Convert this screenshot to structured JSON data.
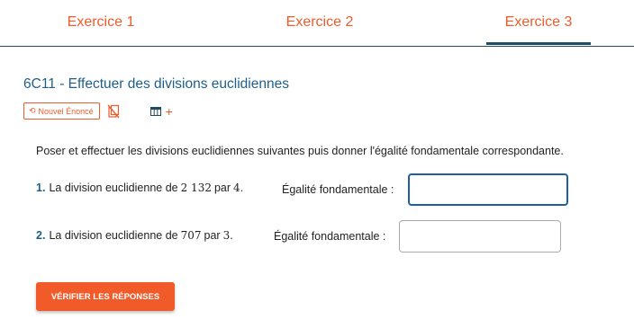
{
  "tabs": [
    {
      "label": "Exercice 1"
    },
    {
      "label": "Exercice 2"
    },
    {
      "label": "Exercice 3",
      "active": true
    }
  ],
  "exercise": {
    "title": "6C11 - Effectuer des divisions euclidiennes",
    "new_statement_label": "Nouvel Énoncé",
    "instruction": "Poser et effectuer les divisions euclidiennes suivantes puis donner l'égalité fondamentale correspondante.",
    "questions": [
      {
        "number": "1.",
        "text_before": "La division euclidienne de",
        "dividend": "2 132",
        "text_mid": "par",
        "divisor": "4",
        "end": ".",
        "equality_label": "Égalité fondamentale :",
        "answer_value": ""
      },
      {
        "number": "2.",
        "text_before": "La division euclidienne de",
        "dividend": "707",
        "text_mid": "par",
        "divisor": "3",
        "end": ".",
        "equality_label": "Égalité fondamentale :",
        "answer_value": ""
      }
    ],
    "verify_label": "VÉRIFIER LES RÉPONSES"
  },
  "colors": {
    "accent": "#f15a29",
    "primary": "#1e5f88",
    "tab_line": "#1e4a63"
  },
  "icons": [
    "refresh-icon",
    "no-copy-icon",
    "table-icon",
    "plus-icon"
  ]
}
